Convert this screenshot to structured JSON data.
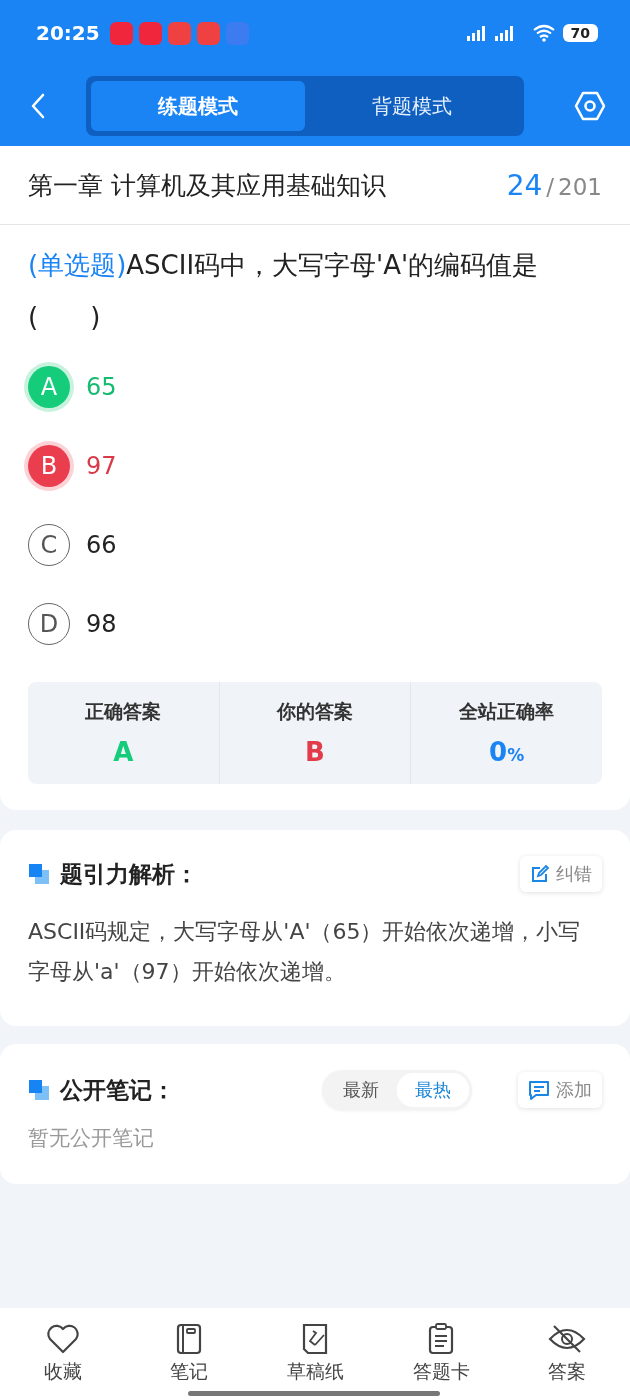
{
  "status_bar": {
    "time": "20:25",
    "battery": "70"
  },
  "mode_tabs": [
    {
      "label": "练题模式",
      "selected": true
    },
    {
      "label": "背题模式",
      "selected": false
    }
  ],
  "chapter": {
    "title": "第一章 计算机及其应用基础知识",
    "current": "24",
    "separator": "/",
    "total": "201"
  },
  "question": {
    "type": "(单选题)",
    "text": "ASCII码中，大写字母'A'的编码值是(　　)"
  },
  "options": [
    {
      "letter": "A",
      "text": "65",
      "kind": "correct"
    },
    {
      "letter": "B",
      "text": "97",
      "kind": "wrong"
    },
    {
      "letter": "C",
      "text": "66",
      "kind": "plain"
    },
    {
      "letter": "D",
      "text": "98",
      "kind": "plain"
    }
  ],
  "result": [
    {
      "label": "正确答案",
      "value": "A",
      "kind": "correct"
    },
    {
      "label": "你的答案",
      "value": "B",
      "kind": "wrong"
    },
    {
      "label": "全站正确率",
      "value": "0",
      "unit": "%",
      "kind": "rate"
    }
  ],
  "analysis": {
    "title": "题引力解析：",
    "action": "纠错",
    "text": "ASCII码规定，大写字母从'A'（65）开始依次递增，小写字母从'a'（97）开始依次递增。"
  },
  "notes": {
    "title": "公开笔记：",
    "sort": [
      {
        "label": "最新",
        "selected": false
      },
      {
        "label": "最热",
        "selected": true
      }
    ],
    "action": "添加",
    "empty": "暂无公开笔记"
  },
  "bottom_nav": [
    {
      "label": "收藏"
    },
    {
      "label": "笔记"
    },
    {
      "label": "草稿纸"
    },
    {
      "label": "答题卡"
    },
    {
      "label": "答案"
    }
  ]
}
